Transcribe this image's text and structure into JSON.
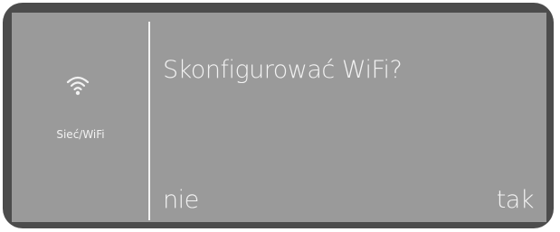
{
  "sidebar": {
    "icon": "wifi-icon",
    "label": "Sieć/WiFi"
  },
  "dialog": {
    "question": "Skonfigurować WiFi?",
    "no_label": "nie",
    "yes_label": "tak"
  },
  "colors": {
    "frame": "#4c4c4c",
    "screen": "#9a9a9a",
    "text": "#f2f2f2"
  }
}
